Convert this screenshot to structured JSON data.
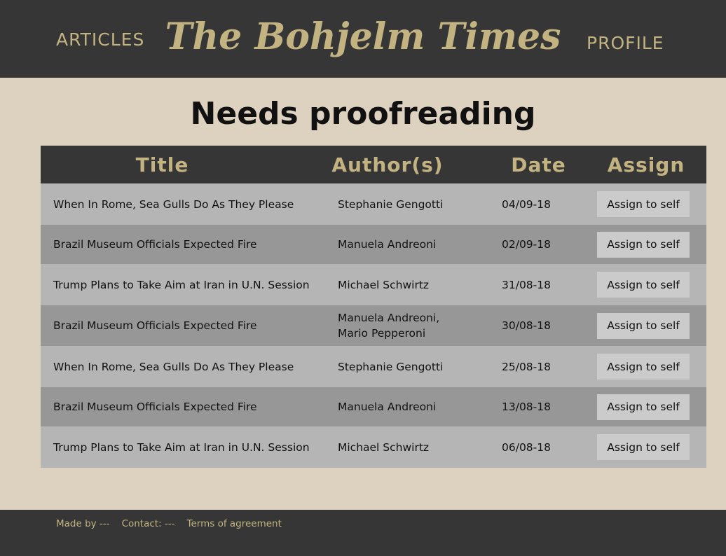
{
  "header": {
    "articles_label": "ARTICLES",
    "brand": "The Bohjelm Times",
    "profile_label": "PROFILE"
  },
  "page": {
    "title": "Needs proofreading"
  },
  "table": {
    "columns": [
      "Title",
      "Author(s)",
      "Date",
      "Assign"
    ],
    "rows": [
      {
        "title": "When In Rome, Sea Gulls Do As They Please",
        "authors": [
          "Stephanie Gengotti"
        ],
        "date": "04/09-18",
        "action": "Assign to self"
      },
      {
        "title": "Brazil Museum Officials Expected Fire",
        "authors": [
          "Manuela Andreoni"
        ],
        "date": "02/09-18",
        "action": "Assign to self"
      },
      {
        "title": "Trump Plans to Take Aim at Iran in U.N. Session",
        "authors": [
          "Michael Schwirtz"
        ],
        "date": "31/08-18",
        "action": "Assign to self"
      },
      {
        "title": "Brazil Museum Officials Expected Fire",
        "authors": [
          "Manuela Andreoni,",
          "Mario Pepperoni"
        ],
        "date": "30/08-18",
        "action": "Assign to self"
      },
      {
        "title": "When In Rome, Sea Gulls Do As They Please",
        "authors": [
          "Stephanie Gengotti"
        ],
        "date": "25/08-18",
        "action": "Assign to self"
      },
      {
        "title": "Brazil Museum Officials Expected Fire",
        "authors": [
          "Manuela Andreoni"
        ],
        "date": "13/08-18",
        "action": "Assign to self"
      },
      {
        "title": "Trump Plans to Take Aim at Iran in U.N. Session",
        "authors": [
          "Michael Schwirtz"
        ],
        "date": "06/08-18",
        "action": "Assign to self"
      }
    ]
  },
  "footer": {
    "made_by": "Made by ---",
    "contact": "Contact: ---",
    "terms": "Terms of agreement"
  },
  "colors": {
    "header_bg": "#363636",
    "accent_gold": "#c2b381",
    "page_bg": "#ddd1c0",
    "row_light": "#b5b5b5",
    "row_dark": "#979797"
  }
}
